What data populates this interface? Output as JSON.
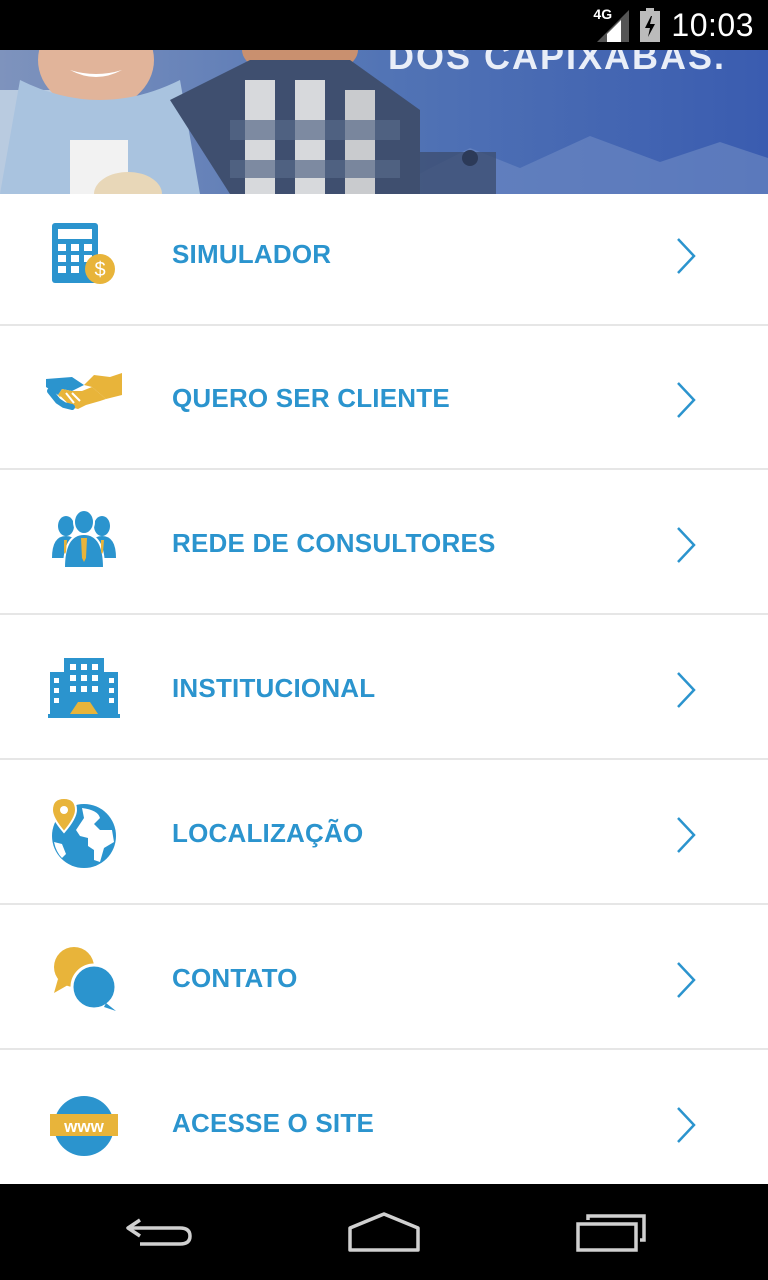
{
  "status_bar": {
    "network": "4G",
    "time": "10:03"
  },
  "banner": {
    "text": "DOS CAPIXABAS."
  },
  "menu": {
    "items": [
      {
        "label": "SIMULADOR",
        "icon": "calculator-dollar-icon"
      },
      {
        "label": "QUERO SER CLIENTE",
        "icon": "handshake-icon"
      },
      {
        "label": "REDE DE CONSULTORES",
        "icon": "consultants-group-icon"
      },
      {
        "label": "INSTITUCIONAL",
        "icon": "building-icon"
      },
      {
        "label": "LOCALIZAÇÃO",
        "icon": "globe-pin-icon"
      },
      {
        "label": "CONTATO",
        "icon": "chat-bubbles-icon"
      },
      {
        "label": "ACESSE O SITE",
        "icon": "www-globe-icon"
      }
    ],
    "chevron_icon": "chevron-right-icon"
  },
  "nav_bar": {
    "buttons": [
      "back-icon",
      "home-icon",
      "recents-icon"
    ]
  },
  "colors": {
    "accent_blue": "#2b94ce",
    "accent_gold": "#e8b43a",
    "divider": "#e6e6e6",
    "status_bar": "#000000"
  }
}
